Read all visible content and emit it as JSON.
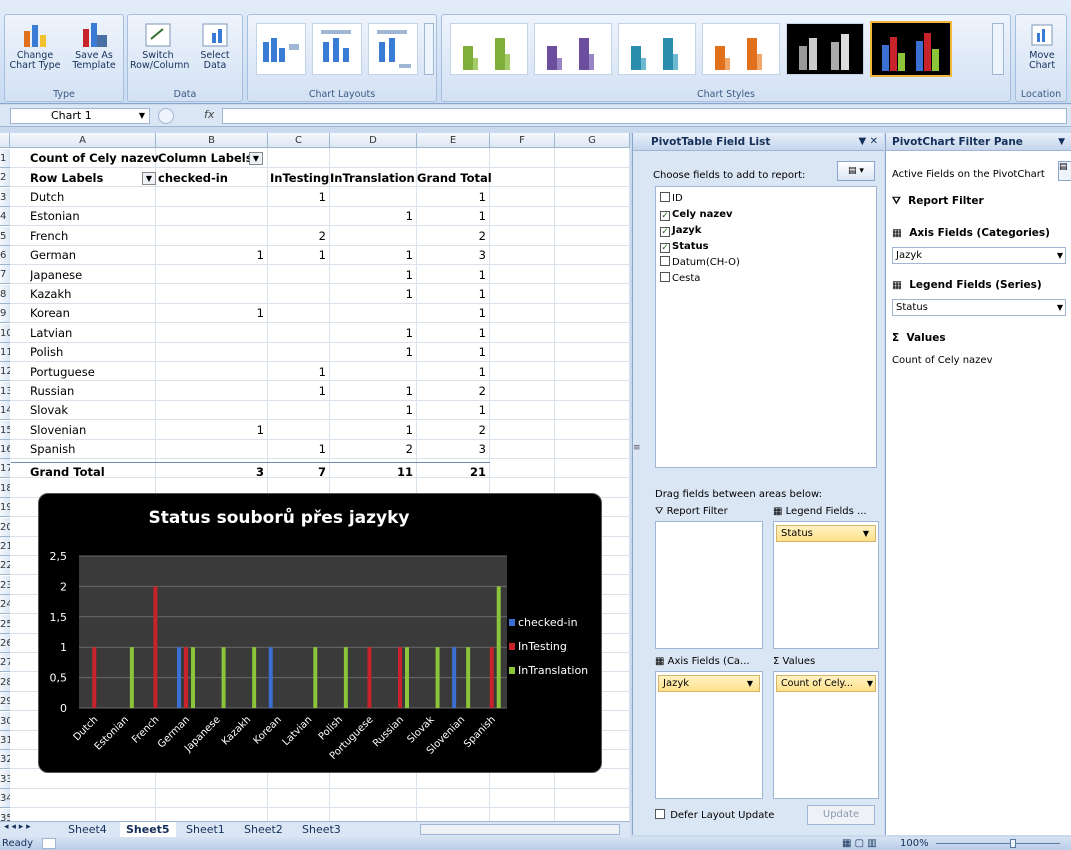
{
  "ribbon": {
    "groups": [
      {
        "label": "Type",
        "buttons": [
          "Change Chart Type",
          "Save As Template"
        ]
      },
      {
        "label": "Data",
        "buttons": [
          "Switch Row/Column",
          "Select Data"
        ]
      },
      {
        "label": "Chart Layouts"
      },
      {
        "label": "Chart Styles"
      },
      {
        "label": "Location",
        "buttons": [
          "Move Chart"
        ]
      }
    ]
  },
  "formula_bar": {
    "name_box": "Chart 1",
    "fx": "fx"
  },
  "columns": [
    "A",
    "B",
    "C",
    "D",
    "E",
    "F",
    "G"
  ],
  "rows": [
    "1",
    "2",
    "3",
    "4",
    "5",
    "6",
    "7",
    "8",
    "9",
    "10",
    "11",
    "12",
    "13",
    "14",
    "15",
    "16",
    "17",
    "18",
    "19",
    "20",
    "21",
    "22",
    "23",
    "24",
    "25",
    "26",
    "27",
    "28",
    "29",
    "30",
    "31",
    "32",
    "33",
    "34",
    "35"
  ],
  "pivot": {
    "corner": "Count of Cely nazev",
    "col_labels": "Column Labels",
    "row_labels": "Row Labels",
    "headers": [
      "checked-in",
      "InTesting",
      "InTranslation",
      "Grand Total"
    ],
    "data": [
      [
        "Dutch",
        "",
        "1",
        "",
        "1"
      ],
      [
        "Estonian",
        "",
        "",
        "1",
        "1"
      ],
      [
        "French",
        "",
        "2",
        "",
        "2"
      ],
      [
        "German",
        "1",
        "1",
        "1",
        "3"
      ],
      [
        "Japanese",
        "",
        "",
        "1",
        "1"
      ],
      [
        "Kazakh",
        "",
        "",
        "1",
        "1"
      ],
      [
        "Korean",
        "1",
        "",
        "",
        "1"
      ],
      [
        "Latvian",
        "",
        "",
        "1",
        "1"
      ],
      [
        "Polish",
        "",
        "",
        "1",
        "1"
      ],
      [
        "Portuguese",
        "",
        "1",
        "",
        "1"
      ],
      [
        "Russian",
        "",
        "1",
        "1",
        "2"
      ],
      [
        "Slovak",
        "",
        "",
        "1",
        "1"
      ],
      [
        "Slovenian",
        "1",
        "",
        "1",
        "2"
      ],
      [
        "Spanish",
        "",
        "1",
        "2",
        "3"
      ]
    ],
    "total": [
      "Grand Total",
      "3",
      "7",
      "11",
      "21"
    ]
  },
  "chart_data": {
    "type": "bar",
    "title": "Status souborů přes jazyky",
    "categories": [
      "Dutch",
      "Estonian",
      "French",
      "German",
      "Japanese",
      "Kazakh",
      "Korean",
      "Latvian",
      "Polish",
      "Portuguese",
      "Russian",
      "Slovak",
      "Slovenian",
      "Spanish"
    ],
    "series": [
      {
        "name": "checked-in",
        "color": "#3b6fd1",
        "values": [
          0,
          0,
          0,
          1,
          0,
          0,
          1,
          0,
          0,
          0,
          0,
          0,
          1,
          0
        ]
      },
      {
        "name": "InTesting",
        "color": "#c8232b",
        "values": [
          1,
          0,
          2,
          1,
          0,
          0,
          0,
          0,
          0,
          1,
          1,
          0,
          0,
          1
        ]
      },
      {
        "name": "InTranslation",
        "color": "#8cc43a",
        "values": [
          0,
          1,
          0,
          1,
          1,
          1,
          0,
          1,
          1,
          0,
          1,
          1,
          1,
          2
        ]
      }
    ],
    "ylim": [
      0,
      2.5
    ],
    "yticks": [
      "0",
      "0,5",
      "1",
      "1,5",
      "2",
      "2,5"
    ],
    "legend": "right",
    "grid": true
  },
  "field_list": {
    "title": "PivotTable Field List",
    "prompt": "Choose fields to add to report:",
    "fields": [
      {
        "name": "ID",
        "checked": false
      },
      {
        "name": "Cely nazev",
        "checked": true
      },
      {
        "name": "Jazyk",
        "checked": true
      },
      {
        "name": "Status",
        "checked": true
      },
      {
        "name": "Datum(CH-O)",
        "checked": false
      },
      {
        "name": "Cesta",
        "checked": false
      }
    ],
    "drag_text": "Drag fields between areas below:",
    "areas": {
      "report_filter": "Report Filter",
      "legend_fields": "Legend Fields ...",
      "axis_fields": "Axis Fields (Ca...",
      "values": "Values"
    },
    "legend_item": "Status",
    "axis_item": "Jazyk",
    "values_item": "Count of Cely...",
    "defer": "Defer Layout Update",
    "update": "Update"
  },
  "filter_pane": {
    "title": "PivotChart Filter Pane",
    "active": "Active Fields on the PivotChart",
    "report_filter": "Report Filter",
    "axis": "Axis Fields (Categories)",
    "axis_value": "Jazyk",
    "legend": "Legend Fields (Series)",
    "legend_value": "Status",
    "values": "Values",
    "values_item": "Count of Cely nazev"
  },
  "sheets": [
    "Sheet4",
    "Sheet5",
    "Sheet1",
    "Sheet2",
    "Sheet3"
  ],
  "active_sheet": "Sheet5",
  "status": {
    "ready": "Ready",
    "zoom": "100%"
  }
}
